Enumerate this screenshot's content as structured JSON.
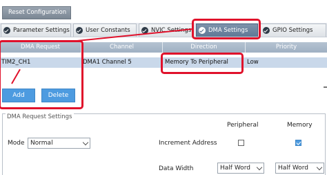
{
  "toolbar": {
    "reset_label": "Reset Configuration"
  },
  "tabs": [
    {
      "label": "Parameter Settings",
      "active": false
    },
    {
      "label": "User Constants",
      "active": false
    },
    {
      "label": "NVIC Settings",
      "active": false
    },
    {
      "label": "DMA Settings",
      "active": true
    },
    {
      "label": "GPIO Settings",
      "active": false
    }
  ],
  "dma_table": {
    "columns": [
      "DMA Request",
      "Channel",
      "Direction",
      "Priority"
    ],
    "rows": [
      {
        "request": "TIM2_CH1",
        "channel": "DMA1 Channel 5",
        "direction": "Memory To Peripheral",
        "priority": "Low"
      }
    ]
  },
  "actions": {
    "add_label": "Add",
    "delete_label": "Delete"
  },
  "request_settings": {
    "legend": "DMA Request Settings",
    "col_peripheral": "Peripheral",
    "col_memory": "Memory",
    "mode_label": "Mode",
    "mode_value": "Normal",
    "increment_label": "Increment Address",
    "peripheral_increment": false,
    "memory_increment": true,
    "data_width_label": "Data Width",
    "peripheral_width": "Half Word",
    "memory_width": "Half Word"
  },
  "colors": {
    "highlight": "#e0112b",
    "accent_tab": "#5f7896",
    "button": "#4d9be0",
    "selected_row": "#c9d8ea"
  }
}
